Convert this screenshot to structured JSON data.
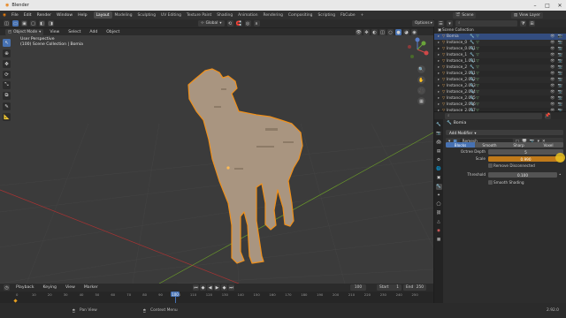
{
  "window": {
    "title": "Blender"
  },
  "menu": {
    "items": [
      "File",
      "Edit",
      "Render",
      "Window",
      "Help"
    ],
    "workspaces": [
      "Layout",
      "Modeling",
      "Sculpting",
      "UV Editing",
      "Texture Paint",
      "Shading",
      "Animation",
      "Rendering",
      "Compositing",
      "Scripting",
      "FbCube"
    ],
    "active_workspace": "Layout",
    "scene_label": "Scene",
    "view_layer_label": "View Layer"
  },
  "viewport": {
    "mode": "Object Mode",
    "menus": [
      "View",
      "Select",
      "Add",
      "Object"
    ],
    "orientation": "Global",
    "options_label": "Options",
    "info_line1": "User Perspective",
    "info_line2": "(100) Scene Collection | Bomia"
  },
  "outliner": {
    "root": "Scene Collection",
    "rows": [
      {
        "name": "Bomia",
        "selected": true
      },
      {
        "name": "Instance_0"
      },
      {
        "name": "Instance_0.001"
      },
      {
        "name": "Instance_1"
      },
      {
        "name": "Instance_1.001"
      },
      {
        "name": "Instance_2"
      },
      {
        "name": "Instance_2.001"
      },
      {
        "name": "Instance_2.002"
      },
      {
        "name": "Instance_2.003"
      },
      {
        "name": "Instance_2.004"
      },
      {
        "name": "Instance_2.005"
      },
      {
        "name": "Instance_2.006"
      },
      {
        "name": "Instance_2.007"
      }
    ]
  },
  "properties": {
    "object_name": "Bomia",
    "add_modifier": "Add Modifier",
    "modifier_name": "Remesh",
    "modes": [
      "Blocks",
      "Smooth",
      "Sharp",
      "Voxel"
    ],
    "active_mode": "Blocks",
    "octree_depth_label": "Octree Depth",
    "octree_depth": "5",
    "scale_label": "Scale",
    "scale": "0.990",
    "remove_disconnected_label": "Remove Disconnected",
    "threshold_label": "Threshold",
    "threshold": "0.100",
    "smooth_shading_label": "Smooth Shading"
  },
  "timeline": {
    "menus": [
      "Playback",
      "Keying",
      "View",
      "Marker"
    ],
    "current_frame": "100",
    "start_label": "Start",
    "start": "1",
    "end_label": "End",
    "end": "250",
    "ticks": [
      "0",
      "10",
      "20",
      "30",
      "40",
      "50",
      "60",
      "70",
      "80",
      "90",
      "100",
      "110",
      "120",
      "130",
      "140",
      "150",
      "160",
      "170",
      "180",
      "190",
      "200",
      "210",
      "220",
      "230",
      "240",
      "250"
    ]
  },
  "status": {
    "left": "Pan View",
    "middle": "Context Menu",
    "version": "2.92.0"
  },
  "colors": {
    "accent": "#4772b3",
    "selection_outline": "#f0901a",
    "model": "#a99580",
    "header": "#2b2b2b",
    "viewport_bg": "#3b3b3b"
  }
}
